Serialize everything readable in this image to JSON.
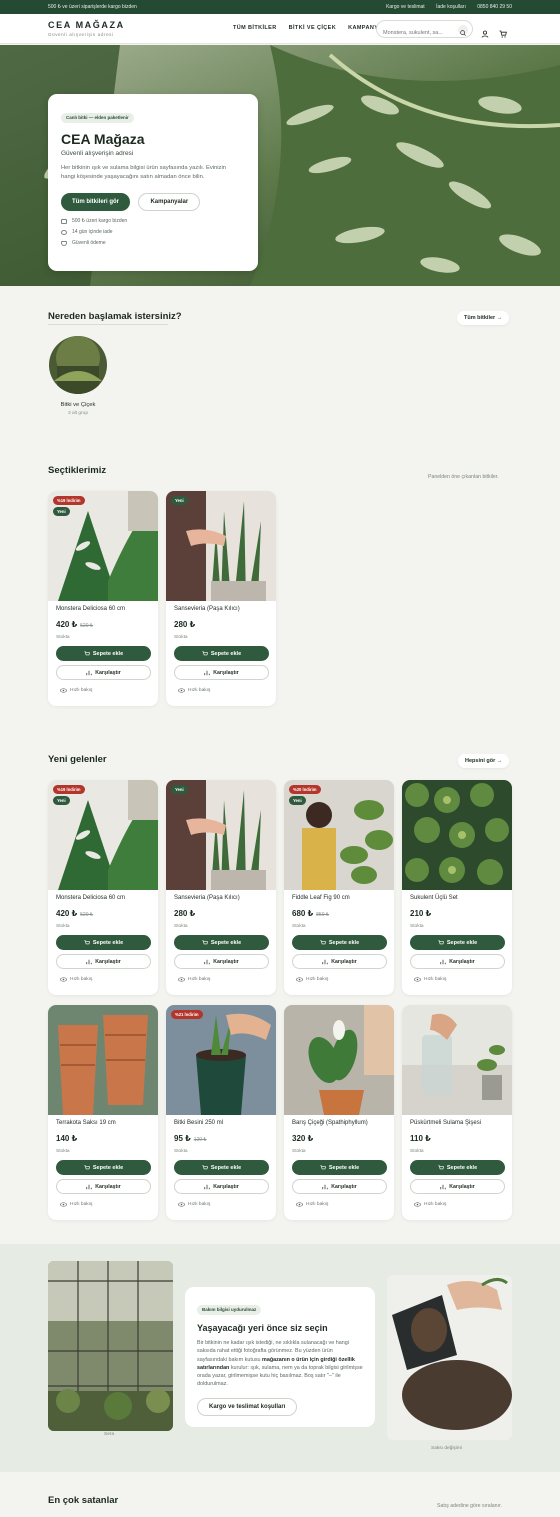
{
  "topbar": {
    "promo": "500 ₺ ve üzeri siparişlerde kargo bizden",
    "links": [
      "Kargo ve teslimat",
      "İade koşulları",
      "0850 840 29 50"
    ]
  },
  "header": {
    "logo": "CEA MAĞAZA",
    "tagline": "Güvenli alışverişin adresi",
    "nav": [
      "TÜM BİTKİLER",
      "BİTKİ VE ÇİÇEK",
      "KAMPANYA"
    ],
    "search_placeholder": "Monstera, sukulent, sa...",
    "icons": [
      "search-icon",
      "user-icon",
      "cart-icon"
    ]
  },
  "hero": {
    "badge": "Canlı bitki — elden paketlenir",
    "title": "CEA Mağaza",
    "subtitle": "Güvenli alışverişin adresi",
    "desc": "Her bitkinin ışık ve sulama bilgisi ürün sayfasında yazılı. Evinizin hangi köşesinde yaşayacağını satın almadan önce bilin.",
    "btn_primary": "Tüm bitkileri gör",
    "btn_secondary": "Kampanyalar",
    "features": [
      "500 ₺ üzeri kargo bizden",
      "14 gün içinde iade",
      "Güvenli ödeme"
    ]
  },
  "categories": {
    "title": "Nereden başlamak istersiniz?",
    "link": "Tüm bitkiler →",
    "items": [
      {
        "name": "Bitki ve Çiçek",
        "count": "3 alt grup"
      }
    ]
  },
  "picks": {
    "title": "Seçtiklerimiz",
    "note": "Panelden öne çıkarılan bitkiler.",
    "items": [
      {
        "name": "Monstera Deliciosa 60 cm",
        "price": "420 ₺",
        "old": "520 ₺",
        "stock": "Stokta",
        "tags": [
          "%19 İndirim",
          "Yeni"
        ]
      },
      {
        "name": "Sansevieria (Paşa Kılıcı)",
        "price": "280 ₺",
        "old": "",
        "stock": "Stokta",
        "tags": [
          "Yeni"
        ]
      }
    ]
  },
  "new": {
    "title": "Yeni gelenler",
    "link": "Hepsini gör →",
    "items": [
      {
        "name": "Monstera Deliciosa 60 cm",
        "price": "420 ₺",
        "old": "520 ₺",
        "stock": "Stokta",
        "tags": [
          "%19 İndirim",
          "Yeni"
        ]
      },
      {
        "name": "Sansevieria (Paşa Kılıcı)",
        "price": "280 ₺",
        "old": "",
        "stock": "Stokta",
        "tags": [
          "Yeni"
        ]
      },
      {
        "name": "Fiddle Leaf Fig 90 cm",
        "price": "680 ₺",
        "old": "850 ₺",
        "stock": "Stokta",
        "tags": [
          "%20 İndirim",
          "Yeni"
        ]
      },
      {
        "name": "Sukulent Üçlü Set",
        "price": "210 ₺",
        "old": "",
        "stock": "Stokta",
        "tags": []
      },
      {
        "name": "Terrakota Saksı 19 cm",
        "price": "140 ₺",
        "old": "",
        "stock": "Stokta",
        "tags": []
      },
      {
        "name": "Bitki Besini 250 ml",
        "price": "95 ₺",
        "old": "120 ₺",
        "stock": "Stokta",
        "tags": [
          "%21 İndirim"
        ]
      },
      {
        "name": "Barış Çiçeği (Spathiphyllum)",
        "price": "320 ₺",
        "old": "",
        "stock": "Stokta",
        "tags": []
      },
      {
        "name": "Püskürtmeli Sulama Şişesi",
        "price": "110 ₺",
        "old": "",
        "stock": "Stokta",
        "tags": []
      }
    ]
  },
  "card_labels": {
    "add": "Sepete ekle",
    "compare": "Karşılaştır",
    "quick": "Hızlı bakış"
  },
  "info": {
    "badge": "Bakım bilgisi uydurulmaz",
    "title": "Yaşayacağı yeri önce siz seçin",
    "p1": "Bir bitkinin ne kadar ışık istediği, ne sıklıkla sulanacağı ve hangi saksıda rahat ettiği fotoğrafta görünmez. Bu yüzden ürün sayfasındaki bakım kutusu ",
    "b1": "mağazanın o ürün için girdiği özellik satırlarından",
    "p2": " kurulur: ışık, sulama, nem ya da toprak bilgisi girilmişse orada yazar, girilmemişse kutu hiç basılmaz. Boş satır \"–\" ile doldurulmaz.",
    "button": "Kargo ve teslimat koşulları",
    "left_caption": "Sera",
    "right_caption": "Saksı değişimi"
  },
  "best": {
    "title": "En çok satanlar",
    "note": "Satış adedine göre sıralanır."
  },
  "colors": {
    "primary": "#2f5a3e",
    "sale": "#b3352b",
    "bg": "#f3f3ef"
  }
}
